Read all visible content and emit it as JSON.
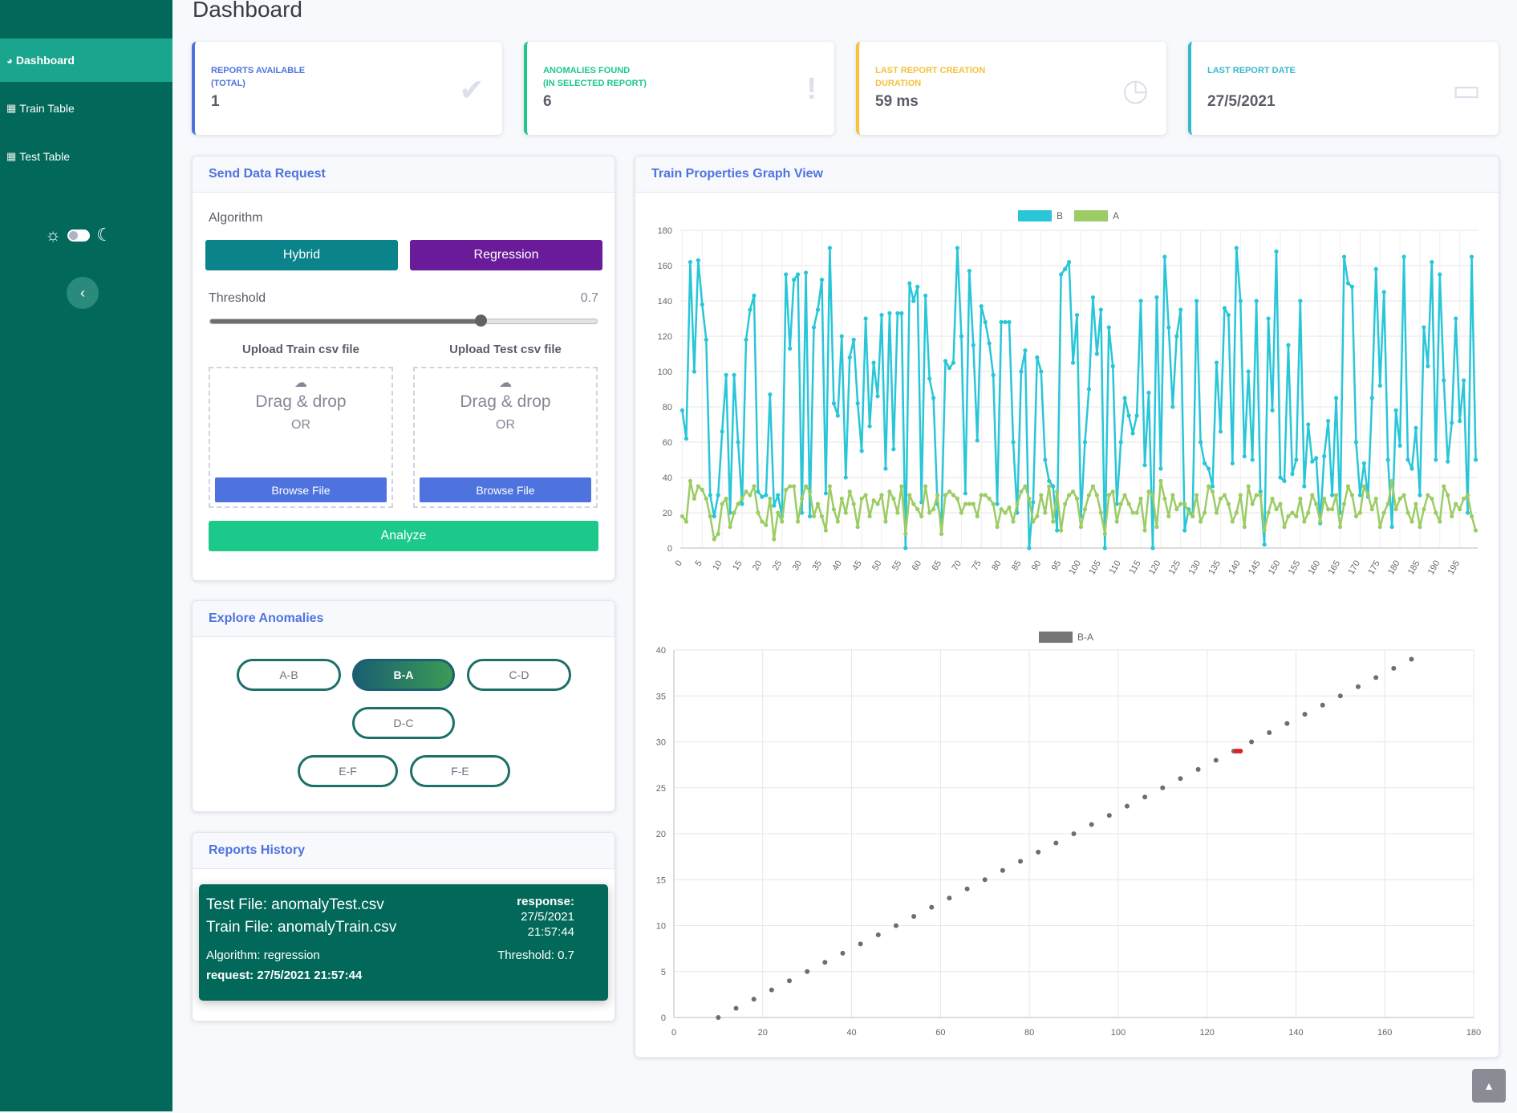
{
  "page": {
    "title": "Dashboard"
  },
  "sidebar": {
    "items": [
      {
        "label": "Dashboard",
        "icon": "tachometer-icon",
        "active": true
      },
      {
        "label": "Train Table",
        "icon": "table-icon",
        "active": false
      },
      {
        "label": "Test Table",
        "icon": "table-icon",
        "active": false
      }
    ],
    "theme_toggle": {
      "light_icon": "sun-icon",
      "dark_icon": "moon-icon"
    },
    "collapse_icon": "chevron-left-icon"
  },
  "stats": [
    {
      "label_line1": "Reports Available",
      "label_line2": "(Total)",
      "value": "1",
      "icon": "check-icon",
      "color": "#4e73df"
    },
    {
      "label_line1": "Anomalies Found",
      "label_line2": "(In Selected Report)",
      "value": "6",
      "icon": "exclamation-icon",
      "color": "#1cc88a"
    },
    {
      "label_line1": "Last Report Creation",
      "label_line2": "Duration",
      "value": "59 ms",
      "icon": "clock-icon",
      "color": "#f6c23e"
    },
    {
      "label_line1": "Last Report Date",
      "label_line2": "",
      "value": "27/5/2021",
      "icon": "calendar-icon",
      "color": "#36b9cc"
    }
  ],
  "send_request": {
    "title": "Send Data Request",
    "algorithm_label": "Algorithm",
    "hybrid_label": "Hybrid",
    "regression_label": "Regression",
    "threshold_label": "Threshold",
    "threshold_value": "0.7",
    "threshold_fraction": 0.7,
    "upload_train_label": "Upload Train csv file",
    "upload_test_label": "Upload Test csv file",
    "drag_drop": "Drag & drop",
    "or": "OR",
    "browse": "Browse File",
    "analyze": "Analyze"
  },
  "explore": {
    "title": "Explore Anomalies",
    "pills": [
      "A-B",
      "B-A",
      "C-D",
      "D-C",
      "E-F",
      "F-E"
    ],
    "active": "B-A"
  },
  "history": {
    "title": "Reports History",
    "test_file": "Test File: anomalyTest.csv",
    "train_file": "Train File: anomalyTrain.csv",
    "response_label": "response:",
    "response_date": "27/5/2021",
    "response_time": "21:57:44",
    "algorithm": "Algorithm: regression",
    "threshold": "Threshold: 0.7",
    "request": "request: 27/5/2021 21:57:44"
  },
  "graph": {
    "title": "Train Properties Graph View"
  },
  "colors": {
    "sidebar": "#02695a",
    "primary": "#4e73df",
    "series_b": "#29c6d8",
    "series_a": "#9ccc65",
    "anomaly": "#e02020"
  },
  "chart_data": [
    {
      "type": "line",
      "legend": "top",
      "series_names": [
        "B",
        "A"
      ],
      "ylim": [
        0,
        180
      ],
      "yticks": [
        0,
        20,
        40,
        60,
        80,
        100,
        120,
        140,
        160,
        180
      ],
      "xticks": [
        "0",
        "5",
        "10",
        "15",
        "20",
        "25",
        "30",
        "35",
        "40",
        "45",
        "50",
        "55",
        "60",
        "65",
        "70",
        "75",
        "80",
        "85",
        "90",
        "95",
        "100",
        "105",
        "110",
        "115",
        "120",
        "125",
        "130",
        "135",
        "140",
        "145",
        "150",
        "155",
        "160",
        "165",
        "170",
        "175",
        "180",
        "185",
        "190",
        "195"
      ],
      "n_points": 200,
      "series": [
        {
          "name": "B",
          "values": [
            78,
            62,
            162,
            100,
            163,
            138,
            118,
            30,
            18,
            30,
            66,
            98,
            20,
            98,
            60,
            25,
            118,
            135,
            143,
            32,
            29,
            30,
            87,
            24,
            30,
            18,
            155,
            113,
            152,
            155,
            20,
            156,
            18,
            125,
            135,
            152,
            31,
            170,
            82,
            75,
            120,
            40,
            108,
            118,
            82,
            55,
            130,
            69,
            105,
            86,
            132,
            45,
            133,
            56,
            133,
            133,
            0,
            150,
            140,
            148,
            26,
            143,
            96,
            85,
            25,
            15,
            106,
            102,
            105,
            170,
            120,
            31,
            157,
            115,
            61,
            137,
            128,
            116,
            98,
            25,
            128,
            128,
            128,
            60,
            20,
            100,
            112,
            0,
            26,
            108,
            100,
            50,
            38,
            35,
            10,
            155,
            158,
            162,
            105,
            132,
            18,
            60,
            90,
            142,
            110,
            135,
            0,
            125,
            103,
            25,
            60,
            85,
            75,
            65,
            75,
            140,
            47,
            88,
            0,
            142,
            45,
            165,
            125,
            80,
            120,
            135,
            10,
            22,
            18,
            140,
            60,
            48,
            45,
            35,
            105,
            66,
            136,
            132,
            48,
            170,
            140,
            52,
            100,
            50,
            140,
            32,
            2,
            130,
            78,
            168,
            40,
            38,
            115,
            42,
            50,
            140,
            35,
            70,
            49,
            51,
            14,
            52,
            72,
            30,
            85,
            20,
            165,
            150,
            148,
            60,
            30,
            48,
            29,
            85,
            158,
            92,
            145,
            50,
            12,
            78,
            58,
            165,
            50,
            45,
            68,
            30,
            125,
            103,
            162,
            50,
            155,
            95,
            49,
            71,
            130,
            72,
            95,
            20,
            165,
            50
          ]
        },
        {
          "name": "A",
          "values": [
            18,
            15,
            38,
            28,
            35,
            33,
            28,
            18,
            5,
            8,
            25,
            28,
            12,
            20,
            25,
            28,
            32,
            30,
            35,
            20,
            15,
            13,
            28,
            5,
            20,
            15,
            33,
            35,
            35,
            15,
            28,
            35,
            32,
            18,
            25,
            18,
            10,
            35,
            22,
            15,
            28,
            20,
            32,
            25,
            12,
            28,
            30,
            18,
            27,
            25,
            30,
            15,
            32,
            28,
            20,
            35,
            8,
            30,
            25,
            22,
            18,
            35,
            20,
            22,
            30,
            8,
            30,
            32,
            30,
            28,
            20,
            25,
            25,
            25,
            18,
            30,
            30,
            28,
            25,
            12,
            22,
            20,
            23,
            15,
            25,
            32,
            35,
            28,
            15,
            18,
            30,
            20,
            35,
            15,
            32,
            10,
            25,
            30,
            32,
            28,
            12,
            22,
            30,
            35,
            30,
            20,
            8,
            30,
            32,
            15,
            25,
            30,
            25,
            20,
            20,
            28,
            10,
            32,
            30,
            12,
            38,
            28,
            18,
            30,
            22,
            25,
            25,
            20,
            18,
            30,
            15,
            20,
            35,
            32,
            20,
            28,
            30,
            25,
            15,
            20,
            30,
            12,
            35,
            25,
            30,
            30,
            10,
            20,
            28,
            22,
            25,
            12,
            18,
            20,
            18,
            28,
            15,
            20,
            30,
            25,
            15,
            28,
            22,
            22,
            30,
            12,
            25,
            35,
            30,
            18,
            20,
            35,
            30,
            22,
            28,
            12,
            20,
            25,
            38,
            22,
            28,
            30,
            20,
            15,
            25,
            12,
            22,
            30,
            28,
            20,
            15,
            35,
            30,
            18,
            25,
            22,
            28,
            30,
            18,
            10
          ]
        }
      ]
    },
    {
      "type": "scatter",
      "legend": "top",
      "series_names": [
        "B-A"
      ],
      "xlim": [
        0,
        180
      ],
      "ylim": [
        0,
        40
      ],
      "xticks": [
        0,
        20,
        40,
        60,
        80,
        100,
        120,
        140,
        160,
        180
      ],
      "yticks": [
        0,
        5,
        10,
        15,
        20,
        25,
        30,
        35,
        40
      ],
      "series": [
        {
          "name": "B-A",
          "points": [
            [
              10,
              0
            ],
            [
              14,
              1
            ],
            [
              18,
              2
            ],
            [
              22,
              3
            ],
            [
              26,
              4
            ],
            [
              30,
              5
            ],
            [
              34,
              6
            ],
            [
              38,
              7
            ],
            [
              42,
              8
            ],
            [
              46,
              9
            ],
            [
              50,
              10
            ],
            [
              54,
              11
            ],
            [
              58,
              12
            ],
            [
              62,
              13
            ],
            [
              66,
              14
            ],
            [
              70,
              15
            ],
            [
              74,
              16
            ],
            [
              78,
              17
            ],
            [
              82,
              18
            ],
            [
              86,
              19
            ],
            [
              90,
              20
            ],
            [
              94,
              21
            ],
            [
              98,
              22
            ],
            [
              102,
              23
            ],
            [
              106,
              24
            ],
            [
              110,
              25
            ],
            [
              114,
              26
            ],
            [
              118,
              27
            ],
            [
              122,
              28
            ],
            [
              126,
              29
            ],
            [
              130,
              30
            ],
            [
              134,
              31
            ],
            [
              138,
              32
            ],
            [
              142,
              33
            ],
            [
              146,
              34
            ],
            [
              150,
              35
            ],
            [
              154,
              36
            ],
            [
              158,
              37
            ],
            [
              162,
              38
            ],
            [
              166,
              39
            ]
          ]
        },
        {
          "name": "anomalies",
          "points": [
            [
              126.5,
              29
            ],
            [
              127,
              29
            ],
            [
              127.5,
              29
            ]
          ]
        }
      ]
    }
  ]
}
